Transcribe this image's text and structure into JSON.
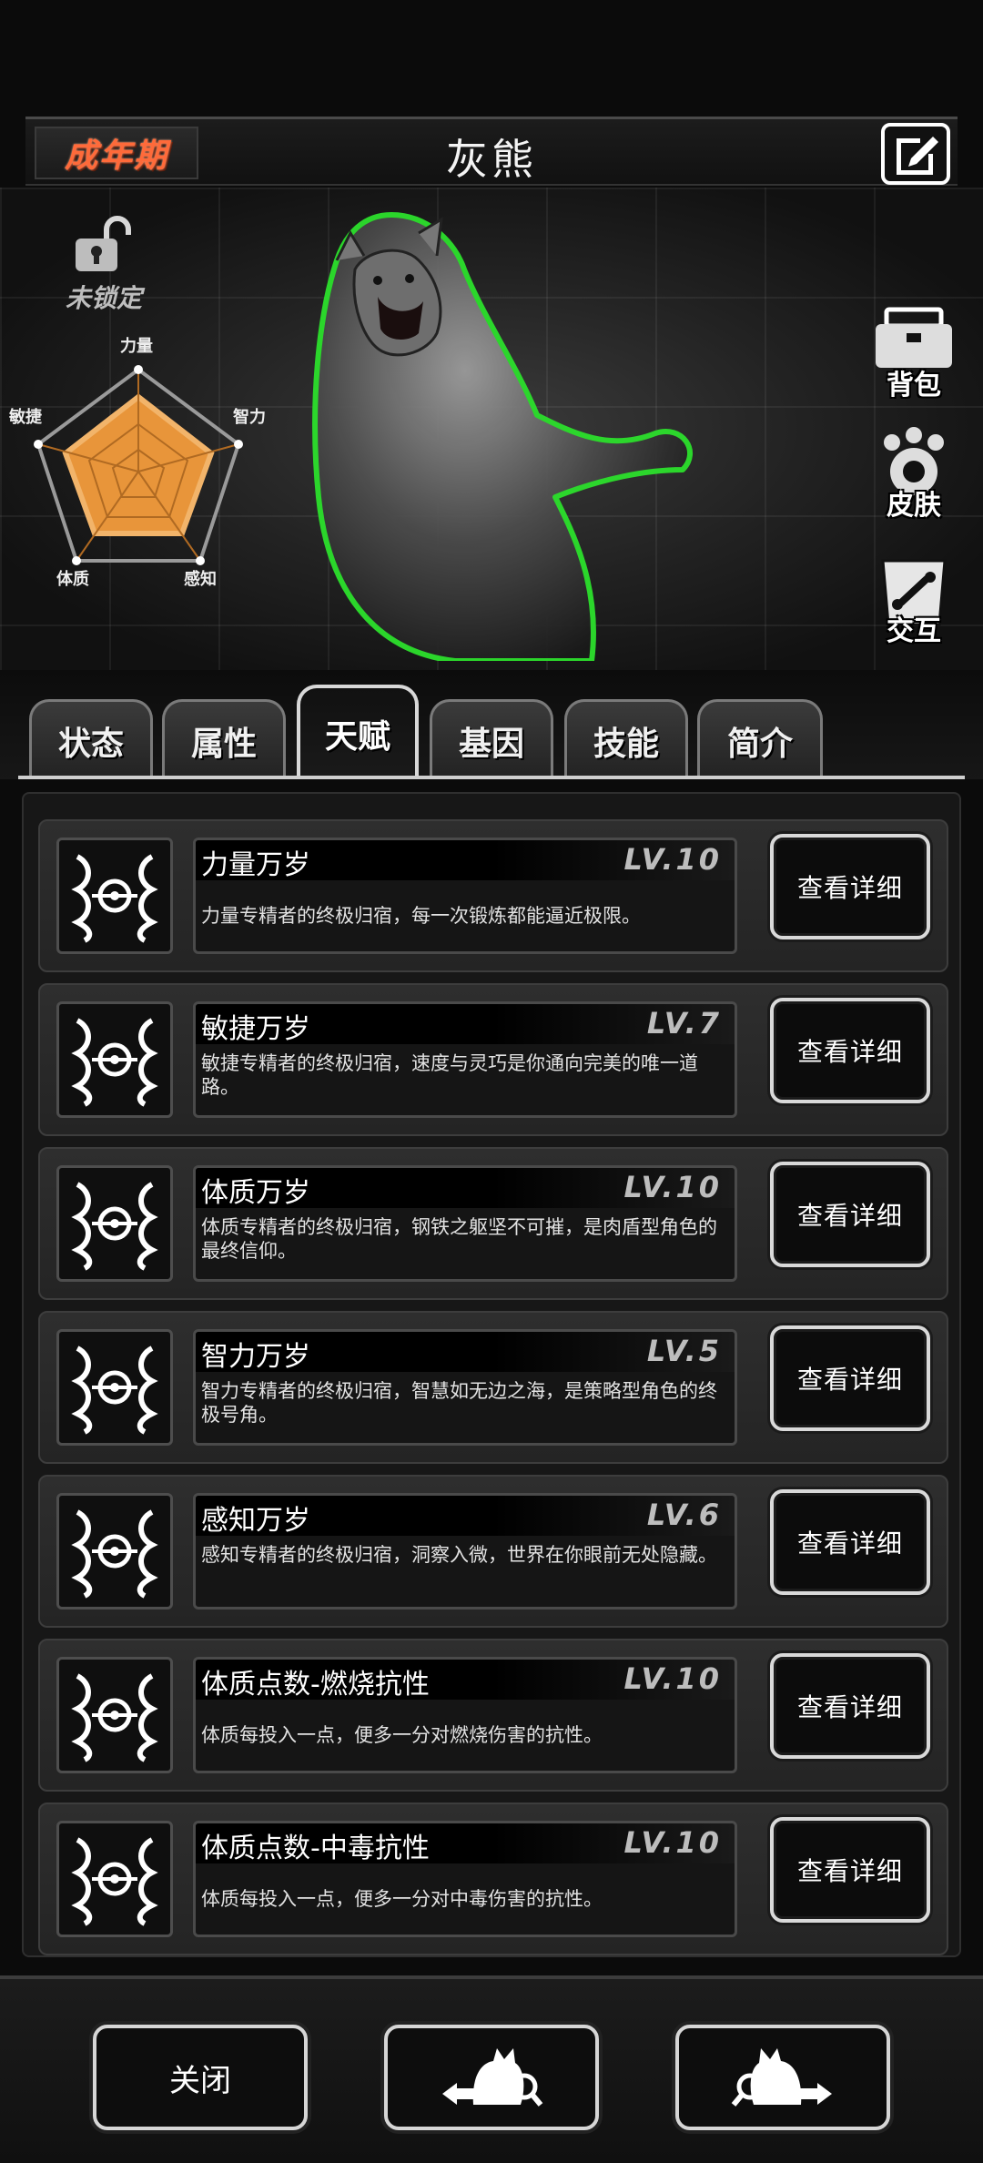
{
  "header": {
    "stage": "成年期",
    "title": "灰熊"
  },
  "hero": {
    "lock_label": "未锁定",
    "radar": {
      "labels": [
        "力量",
        "智力",
        "感知",
        "体质",
        "敏捷"
      ],
      "fill_color": "#e8953a"
    },
    "side_buttons": [
      "背包",
      "皮肤",
      "交互"
    ]
  },
  "tabs": [
    {
      "label": "状态"
    },
    {
      "label": "属性"
    },
    {
      "label": "天赋"
    },
    {
      "label": "基因"
    },
    {
      "label": "技能"
    },
    {
      "label": "简介"
    }
  ],
  "active_tab": "天赋",
  "talents": [
    {
      "name": "力量万岁",
      "level": "LV.10",
      "desc": "力量专精者的终极归宿，每一次锻炼都能逼近极限。",
      "button": "查看详细"
    },
    {
      "name": "敏捷万岁",
      "level": "LV.7",
      "desc": "敏捷专精者的终极归宿，速度与灵巧是你通向完美的唯一道路。",
      "button": "查看详细"
    },
    {
      "name": "体质万岁",
      "level": "LV.10",
      "desc": "体质专精者的终极归宿，钢铁之躯坚不可摧，是肉盾型角色的最终信仰。",
      "button": "查看详细"
    },
    {
      "name": "智力万岁",
      "level": "LV.5",
      "desc": "智力专精者的终极归宿，智慧如无边之海，是策略型角色的终极号角。",
      "button": "查看详细"
    },
    {
      "name": "感知万岁",
      "level": "LV.6",
      "desc": "感知专精者的终极归宿，洞察入微，世界在你眼前无处隐藏。",
      "button": "查看详细"
    },
    {
      "name": "体质点数-燃烧抗性",
      "level": "LV.10",
      "desc": "体质每投入一点，便多一分对燃烧伤害的抗性。",
      "button": "查看详细"
    },
    {
      "name": "体质点数-中毒抗性",
      "level": "LV.10",
      "desc": "体质每投入一点，便多一分对中毒伤害的抗性。",
      "button": "查看详细"
    }
  ],
  "bottom": {
    "close_label": "关闭"
  },
  "icons": {
    "edit": "edit-icon",
    "lock": "unlock-icon",
    "talent": "talent-emblem-icon",
    "prev": "prev-pet-icon",
    "next": "next-pet-icon"
  }
}
